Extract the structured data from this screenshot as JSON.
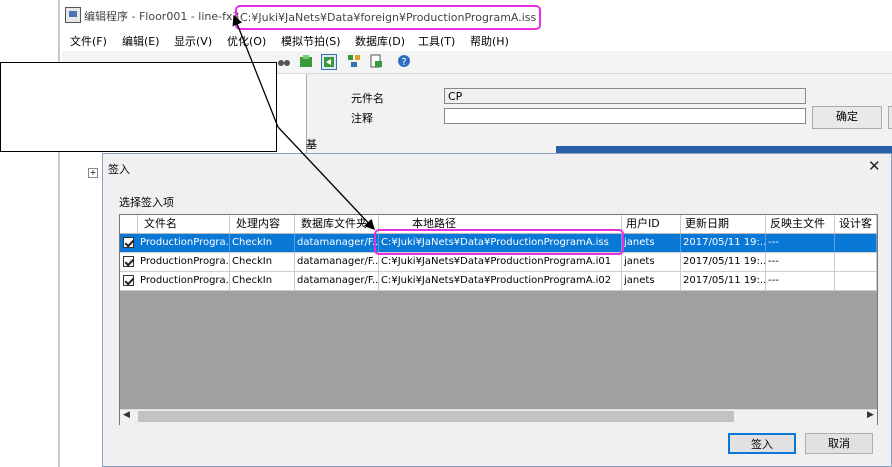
{
  "window": {
    "title_prefix": "编辑程序 - Floor001 - line-fx3",
    "title_path": "C:¥Juki¥JaNets¥Data¥foreign¥ProductionProgramA.iss"
  },
  "menu": [
    "文件(F)",
    "编辑(E)",
    "显示(V)",
    "优化(O)",
    "模拟节拍(S)",
    "数据库(D)",
    "工具(T)",
    "帮助(H)"
  ],
  "properties": {
    "name_label": "元件名",
    "name_value": "CP",
    "note_label": "注释",
    "note_value": "",
    "ok_label": "确定",
    "side_tab": "基"
  },
  "dialog": {
    "title": "签入",
    "section_label": "选择签入项",
    "columns": [
      "文件名",
      "处理内容",
      "数据库文件夹",
      "本地路径",
      "用户ID",
      "更新日期",
      "反映主文件",
      "设计客"
    ],
    "rows": [
      {
        "checked": true,
        "file": "ProductionProgra...",
        "action": "CheckIn",
        "db_folder": "datamanager/F...",
        "local_path": "C:¥Juki¥JaNets¥Data¥ProductionProgramA.iss",
        "user": "janets",
        "date": "2017/05/11 19:...",
        "reflect": "---",
        "design": ""
      },
      {
        "checked": true,
        "file": "ProductionProgra...",
        "action": "CheckIn",
        "db_folder": "datamanager/F...",
        "local_path": "C:¥Juki¥JaNets¥Data¥ProductionProgramA.i01",
        "user": "janets",
        "date": "2017/05/11 19:...",
        "reflect": "---",
        "design": ""
      },
      {
        "checked": true,
        "file": "ProductionProgra...",
        "action": "CheckIn",
        "db_folder": "datamanager/F...",
        "local_path": "C:¥Juki¥JaNets¥Data¥ProductionProgramA.i02",
        "user": "janets",
        "date": "2017/05/11 19:...",
        "reflect": "---",
        "design": ""
      }
    ],
    "ok_label": "签入",
    "cancel_label": "取消"
  },
  "colors": {
    "highlight": "#e62fe0",
    "selection": "#0a78d7"
  }
}
